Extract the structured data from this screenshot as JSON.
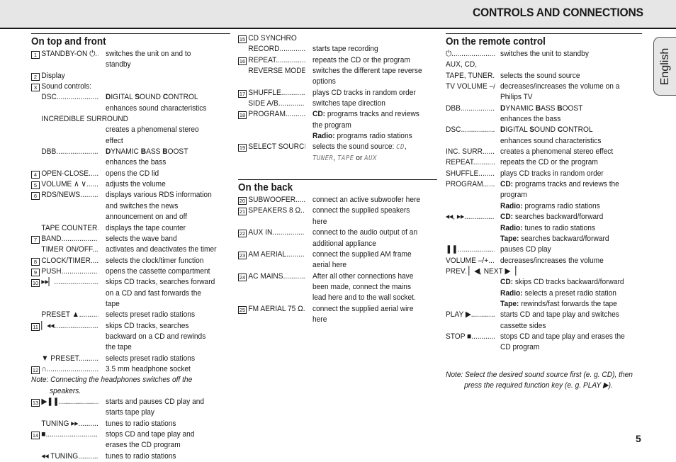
{
  "header": {
    "title": "CONTROLS AND CONNECTIONS"
  },
  "language_tab": "English",
  "page_number": "5",
  "sections": {
    "top_front": {
      "title": "On top and front",
      "rows": [
        {
          "num": "1",
          "label": "STANDBY-ON ⏻",
          "desc": "switches the unit on and to standby"
        },
        {
          "num": "2",
          "label": "Display",
          "desc": ""
        },
        {
          "num": "3",
          "label": "Sound controls:",
          "desc": ""
        },
        {
          "num": "",
          "label": "DSC",
          "desc_html": "<b>D</b>IGITAL <b>S</b>OUND <b>C</b>ONTROL\nenhances sound characteristics"
        },
        {
          "num": "",
          "label": "INCREDIBLE SURROUND",
          "desc": ""
        },
        {
          "num": "",
          "label": "",
          "desc": "creates a phenomenal stereo effect"
        },
        {
          "num": "",
          "label": "DBB",
          "desc_html": "<b>D</b>YNAMIC <b>B</b>ASS <b>B</b>OOST\nenhances the bass"
        },
        {
          "num": "4",
          "label": "OPEN·CLOSE",
          "desc": "opens the CD lid"
        },
        {
          "num": "5",
          "label": "VOLUME ∧ ∨",
          "desc": "adjusts the volume"
        },
        {
          "num": "6",
          "label": "RDS/NEWS",
          "desc": "displays various RDS information and switches the news announcement on and off"
        },
        {
          "num": "",
          "label": "TAPE COUNTER",
          "desc": "displays the tape counter"
        },
        {
          "num": "7",
          "label": "BAND",
          "desc": "selects the wave band"
        },
        {
          "num": "",
          "label": "TIMER ON/OFF",
          "desc": "activates and deactivates the timer"
        },
        {
          "num": "8",
          "label": "CLOCK/TIMER",
          "desc": "selects the clock/timer function"
        },
        {
          "num": "9",
          "label": "PUSH",
          "desc": "opens the cassette compartment"
        },
        {
          "num": "10",
          "label": "▸▸▏",
          "desc": "skips CD tracks, searches forward on a CD and fast forwards the tape"
        },
        {
          "num": "",
          "label": "PRESET ▲",
          "desc": "selects preset radio stations"
        },
        {
          "num": "11",
          "label": "▏◂◂",
          "desc": "skips CD tracks, searches backward on a CD and rewinds the tape"
        },
        {
          "num": "",
          "label": "▼ PRESET",
          "desc": "selects preset radio stations"
        },
        {
          "num": "12",
          "label": "∩",
          "desc": "3.5 mm headphone socket"
        }
      ],
      "note": "Note: Connecting the headphones switches off the",
      "note_cont": "speakers.",
      "rows2": [
        {
          "num": "13",
          "label": "▶❚❚",
          "desc": "starts and pauses CD play and starts tape play"
        },
        {
          "num": "",
          "label": "TUNING ▸▸",
          "desc": "tunes to radio stations"
        },
        {
          "num": "14",
          "label": "■",
          "desc": "stops CD and tape play and erases the CD program"
        },
        {
          "num": "",
          "label": "◂◂ TUNING",
          "desc": "tunes to radio stations"
        }
      ]
    },
    "top_front_cont": {
      "rows": [
        {
          "num": "15",
          "label": "CD SYNCHRO",
          "desc": ""
        },
        {
          "num": "",
          "label": "RECORD",
          "desc": "starts tape recording"
        },
        {
          "num": "16",
          "label": "REPEAT",
          "desc": "repeats the CD or the program"
        },
        {
          "num": "",
          "label": "REVERSE MODE",
          "desc": "switches the different tape reverse options"
        },
        {
          "num": "17",
          "label": "SHUFFLE",
          "desc": "plays CD tracks in random order"
        },
        {
          "num": "",
          "label": "SIDE A/B",
          "desc": "switches tape direction"
        },
        {
          "num": "18",
          "label": "PROGRAM",
          "desc_html": "<b>CD:</b> programs tracks and reviews the program\n<b>Radio:</b> programs radio stations"
        },
        {
          "num": "19",
          "label": "SELECT SOURCE",
          "desc_html": "selects the sound source: <span class=\"lcd\">CD</span>,\n<span class=\"lcd\">TUNER</span>, <span class=\"lcd\">TAPE</span> or <span class=\"lcd\">AUX</span>"
        }
      ]
    },
    "back": {
      "title": "On the back",
      "rows": [
        {
          "num": "20",
          "label": "SUBWOOFER",
          "desc": "connect an active subwoofer here"
        },
        {
          "num": "21",
          "label": "SPEAKERS 8 Ω",
          "desc": "connect the supplied speakers here"
        },
        {
          "num": "22",
          "label": "AUX IN",
          "desc": "connect to the audio output of an additional appliance"
        },
        {
          "num": "23",
          "label": "AM AERIAL",
          "desc": "connect the supplied AM frame aerial here"
        },
        {
          "num": "24",
          "label": "AC MAINS",
          "desc": "After all other connections have been made, connect the mains lead here and to the wall socket."
        },
        {
          "num": "25",
          "label": "FM AERIAL 75 Ω",
          "desc": "connect the supplied aerial wire here"
        }
      ]
    },
    "remote": {
      "title": "On the remote control",
      "rows": [
        {
          "label": "⏻",
          "desc": "switches the unit to standby"
        },
        {
          "label": "AUX, CD,",
          "desc": "",
          "nodots": true
        },
        {
          "label": "TAPE, TUNER",
          "desc": "selects the sound source"
        },
        {
          "label": "TV VOLUME –/+",
          "desc": "decreases/increases the volume on a Philips TV"
        },
        {
          "label": "DBB",
          "desc_html": "<b>D</b>YNAMIC <b>B</b>ASS <b>B</b>OOST\nenhances the bass"
        },
        {
          "label": "DSC",
          "desc_html": "<b>D</b>IGITAL <b>S</b>OUND <b>C</b>ONTROL\nenhances sound characteristics"
        },
        {
          "label": "INC. SURR.",
          "desc": "creates a phenomenal stereo effect"
        },
        {
          "label": "REPEAT",
          "desc": "repeats the CD or the program"
        },
        {
          "label": "SHUFFLE",
          "desc": "plays CD tracks in random order"
        },
        {
          "label": "PROGRAM",
          "desc_html": "<b>CD:</b> programs tracks and reviews the program\n<b>Radio:</b> programs radio stations"
        },
        {
          "label": "◂◂, ▸▸",
          "desc_html": "<b>CD:</b> searches backward/forward\n<b>Radio:</b> tunes to radio stations\n<b>Tape:</b> searches backward/forward"
        },
        {
          "label": "❚❚",
          "desc": "pauses CD play"
        },
        {
          "label": "VOLUME –/+",
          "desc": "decreases/increases the volume"
        },
        {
          "label": "PREV. ▏◀, NEXT ▶▕",
          "desc": "",
          "nodots": true
        },
        {
          "label": "",
          "desc_html": "<b>CD:</b> skips CD tracks backward/forward\n<b>Radio:</b> selects a preset radio station\n<b>Tape:</b> rewinds/fast forwards the tape"
        },
        {
          "label": "PLAY ▶",
          "desc": "starts CD and tape play and switches cassette sides"
        },
        {
          "label": "STOP ■",
          "desc": "stops CD and tape play and erases the CD program"
        }
      ],
      "note": "Note: Select the desired sound source first (e. g. CD), then",
      "note_cont": "press the required function key (e. g. PLAY ▶)."
    }
  }
}
